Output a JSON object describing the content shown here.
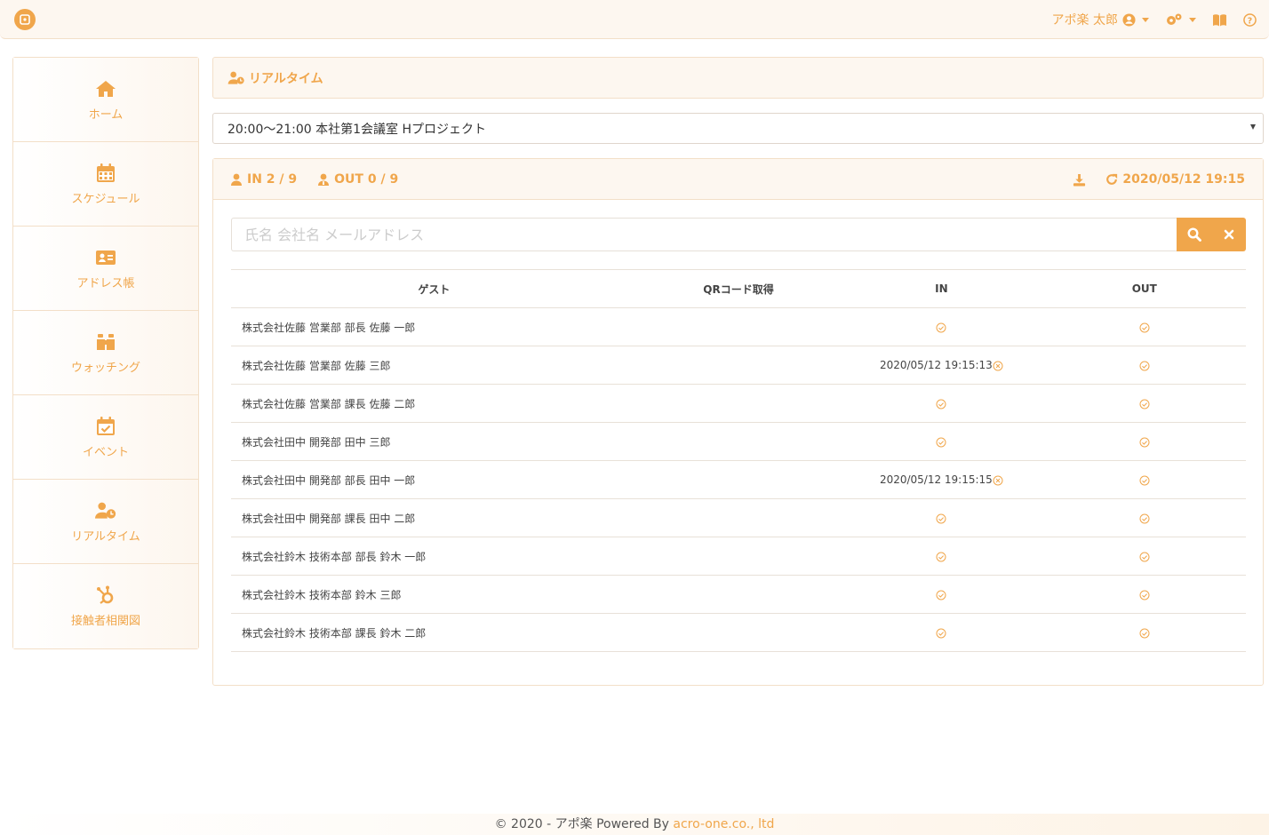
{
  "header": {
    "user_name": "アポ楽 太郎"
  },
  "sidebar": {
    "items": [
      {
        "label": "ホーム",
        "icon": "home-icon"
      },
      {
        "label": "スケジュール",
        "icon": "calendar-icon"
      },
      {
        "label": "アドレス帳",
        "icon": "address-card-icon"
      },
      {
        "label": "ウォッチング",
        "icon": "binoculars-icon"
      },
      {
        "label": "イベント",
        "icon": "calendar-check-icon"
      },
      {
        "label": "リアルタイム",
        "icon": "user-clock-icon"
      },
      {
        "label": "接触者相関図",
        "icon": "hubspot-icon"
      }
    ]
  },
  "page": {
    "title": "リアルタイム"
  },
  "meeting_select": {
    "value": "20:00～21:00 本社第1会議室 Hプロジェクト"
  },
  "stats": {
    "in_label": "IN 2 / 9",
    "out_label": "OUT 0 / 9",
    "timestamp": "2020/05/12 19:15"
  },
  "search": {
    "placeholder": "氏名 会社名 メールアドレス"
  },
  "table": {
    "headers": [
      "ゲスト",
      "QRコード取得",
      "IN",
      "OUT"
    ],
    "rows": [
      {
        "guest": "株式会社佐藤 営業部 部長 佐藤 一郎",
        "qr": "",
        "in": "",
        "out": ""
      },
      {
        "guest": "株式会社佐藤 営業部 佐藤 三郎",
        "qr": "",
        "in": "2020/05/12 19:15:13",
        "out": ""
      },
      {
        "guest": "株式会社佐藤 営業部 課長 佐藤 二郎",
        "qr": "",
        "in": "",
        "out": ""
      },
      {
        "guest": "株式会社田中 開発部 田中 三郎",
        "qr": "",
        "in": "",
        "out": ""
      },
      {
        "guest": "株式会社田中 開発部 部長 田中 一郎",
        "qr": "",
        "in": "2020/05/12 19:15:15",
        "out": ""
      },
      {
        "guest": "株式会社田中 開発部 課長 田中 二郎",
        "qr": "",
        "in": "",
        "out": ""
      },
      {
        "guest": "株式会社鈴木 技術本部 部長 鈴木 一郎",
        "qr": "",
        "in": "",
        "out": ""
      },
      {
        "guest": "株式会社鈴木 技術本部 鈴木 三郎",
        "qr": "",
        "in": "",
        "out": ""
      },
      {
        "guest": "株式会社鈴木 技術本部 課長 鈴木 二郎",
        "qr": "",
        "in": "",
        "out": ""
      }
    ]
  },
  "footer": {
    "copyright": "© 2020 - アポ楽 Powered By ",
    "link": "acro-one.co., ltd"
  },
  "colors": {
    "accent": "#F0A64B"
  }
}
